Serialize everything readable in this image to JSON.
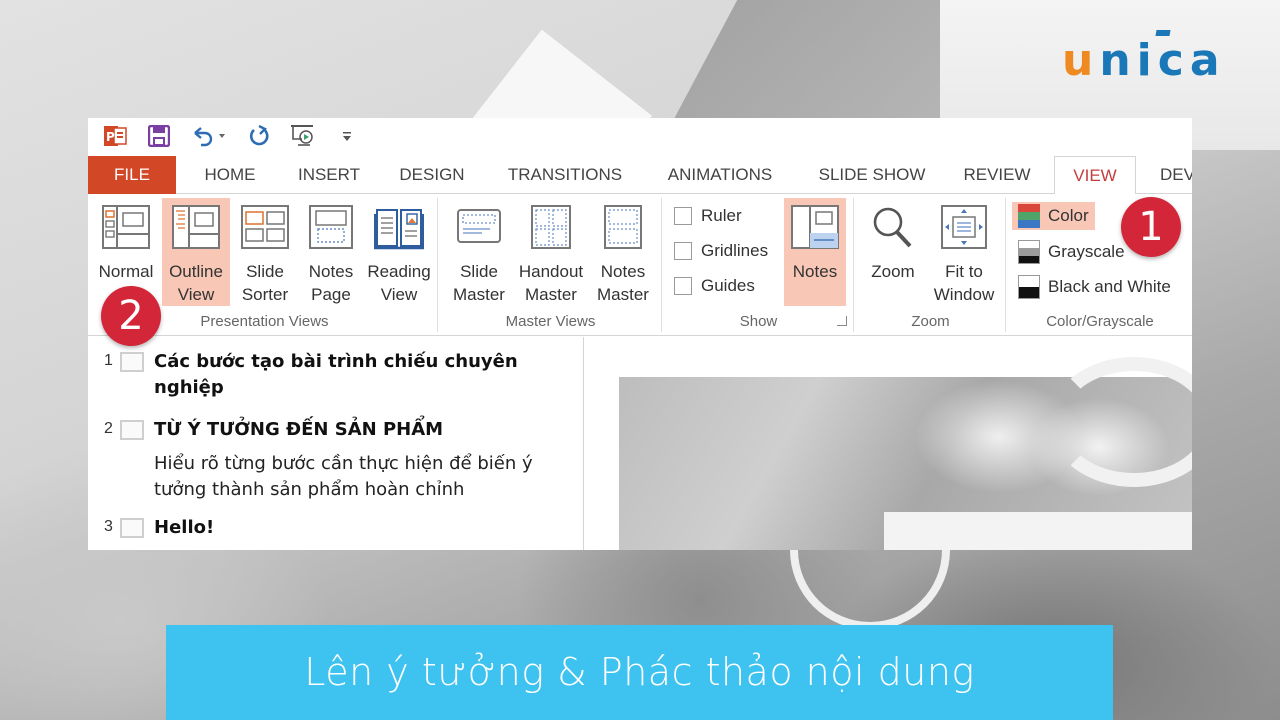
{
  "logo": {
    "first": "u",
    "rest": "nica"
  },
  "quick_access": {
    "icons": [
      "powerpoint-logo-icon",
      "save-icon",
      "undo-icon",
      "redo-icon",
      "start-from-beginning-icon",
      "customize-qat-icon"
    ]
  },
  "tabs": [
    {
      "label": "FILE"
    },
    {
      "label": "HOME"
    },
    {
      "label": "INSERT"
    },
    {
      "label": "DESIGN"
    },
    {
      "label": "TRANSITIONS"
    },
    {
      "label": "ANIMATIONS"
    },
    {
      "label": "SLIDE SHOW"
    },
    {
      "label": "REVIEW"
    },
    {
      "label": "VIEW",
      "active": true
    },
    {
      "label": "DEV"
    }
  ],
  "ribbon": {
    "presentation_views": {
      "label": "Presentation Views",
      "buttons": [
        {
          "line1": "Normal",
          "line2": ""
        },
        {
          "line1": "Outline",
          "line2": "View",
          "selected": true
        },
        {
          "line1": "Slide",
          "line2": "Sorter"
        },
        {
          "line1": "Notes",
          "line2": "Page"
        },
        {
          "line1": "Reading",
          "line2": "View"
        }
      ]
    },
    "master_views": {
      "label": "Master Views",
      "buttons": [
        {
          "line1": "Slide",
          "line2": "Master"
        },
        {
          "line1": "Handout",
          "line2": "Master"
        },
        {
          "line1": "Notes",
          "line2": "Master"
        }
      ]
    },
    "show": {
      "label": "Show",
      "checkboxes": [
        {
          "label": "Ruler",
          "checked": false
        },
        {
          "label": "Gridlines",
          "checked": false
        },
        {
          "label": "Guides",
          "checked": false
        }
      ],
      "notes_button": {
        "label": "Notes",
        "selected": true
      }
    },
    "zoom": {
      "label": "Zoom",
      "buttons": [
        {
          "line1": "Zoom",
          "line2": ""
        },
        {
          "line1": "Fit to",
          "line2": "Window"
        }
      ]
    },
    "color_grayscale": {
      "label": "Color/Grayscale",
      "options": [
        {
          "label": "Color",
          "selected": true
        },
        {
          "label": "Grayscale"
        },
        {
          "label": "Black and White"
        }
      ]
    }
  },
  "outline": [
    {
      "num": "1",
      "title": "Các bước tạo bài trình chiếu chuyên nghiệp",
      "body": ""
    },
    {
      "num": "2",
      "title": "TỪ Ý TƯỞNG ĐẾN SẢN PHẨM",
      "body": "Hiểu rõ từng bước cần thực hiện để biến ý tưởng thành sản phẩm hoàn chỉnh"
    },
    {
      "num": "3",
      "title": "Hello!",
      "body": ""
    }
  ],
  "badges": {
    "one": "1",
    "two": "2"
  },
  "caption": "Lên ý tưởng & Phác thảo nội dung",
  "colors": {
    "file_tab": "#d24726",
    "active_tab_text": "#c43e3e",
    "selection": "#f8c7b6",
    "badge": "#d32638",
    "caption_bg": "#3ec3f0",
    "logo_orange": "#ef8a22",
    "logo_blue": "#1a78b8"
  }
}
